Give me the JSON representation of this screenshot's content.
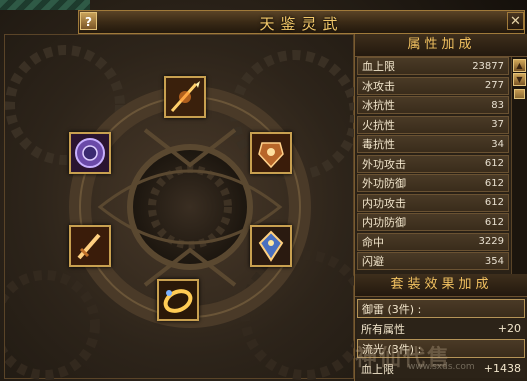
{
  "window": {
    "title": "天鉴灵武",
    "help_label": "?",
    "close_label": "✕"
  },
  "slots": [
    {
      "name": "top",
      "icon": "spear-icon"
    },
    {
      "name": "upper-left",
      "icon": "purple-shield-icon"
    },
    {
      "name": "upper-right",
      "icon": "armor-icon"
    },
    {
      "name": "lower-left",
      "icon": "dagger-icon"
    },
    {
      "name": "lower-right",
      "icon": "gem-icon"
    },
    {
      "name": "bottom",
      "icon": "ring-icon"
    }
  ],
  "attributes": {
    "title": "属性加成",
    "rows": [
      {
        "label": "血上限",
        "value": "23877"
      },
      {
        "label": "冰攻击",
        "value": "277"
      },
      {
        "label": "冰抗性",
        "value": "83"
      },
      {
        "label": "火抗性",
        "value": "37"
      },
      {
        "label": "毒抗性",
        "value": "34"
      },
      {
        "label": "外功攻击",
        "value": "612"
      },
      {
        "label": "外功防御",
        "value": "612"
      },
      {
        "label": "内功攻击",
        "value": "612"
      },
      {
        "label": "内功防御",
        "value": "612"
      },
      {
        "label": "命中",
        "value": "3229"
      },
      {
        "label": "闪避",
        "value": "354"
      }
    ],
    "scroll_up": "▲",
    "scroll_down": "▼"
  },
  "suit": {
    "title": "套装效果加成",
    "rows": [
      {
        "type": "name",
        "label": "御雷 (3件) :",
        "value": ""
      },
      {
        "type": "stat",
        "label": "所有属性",
        "value": "+20"
      },
      {
        "type": "name",
        "label": "流光 (3件) :",
        "value": ""
      },
      {
        "type": "stat",
        "label": "血上限",
        "value": "+1438"
      }
    ]
  },
  "watermark": {
    "text": "神仙代售",
    "url": "www.sxds.com"
  },
  "colors": {
    "accent_gold": "#f0c060",
    "frame_gold": "#c8a050",
    "panel_bg": "#2a2116"
  }
}
